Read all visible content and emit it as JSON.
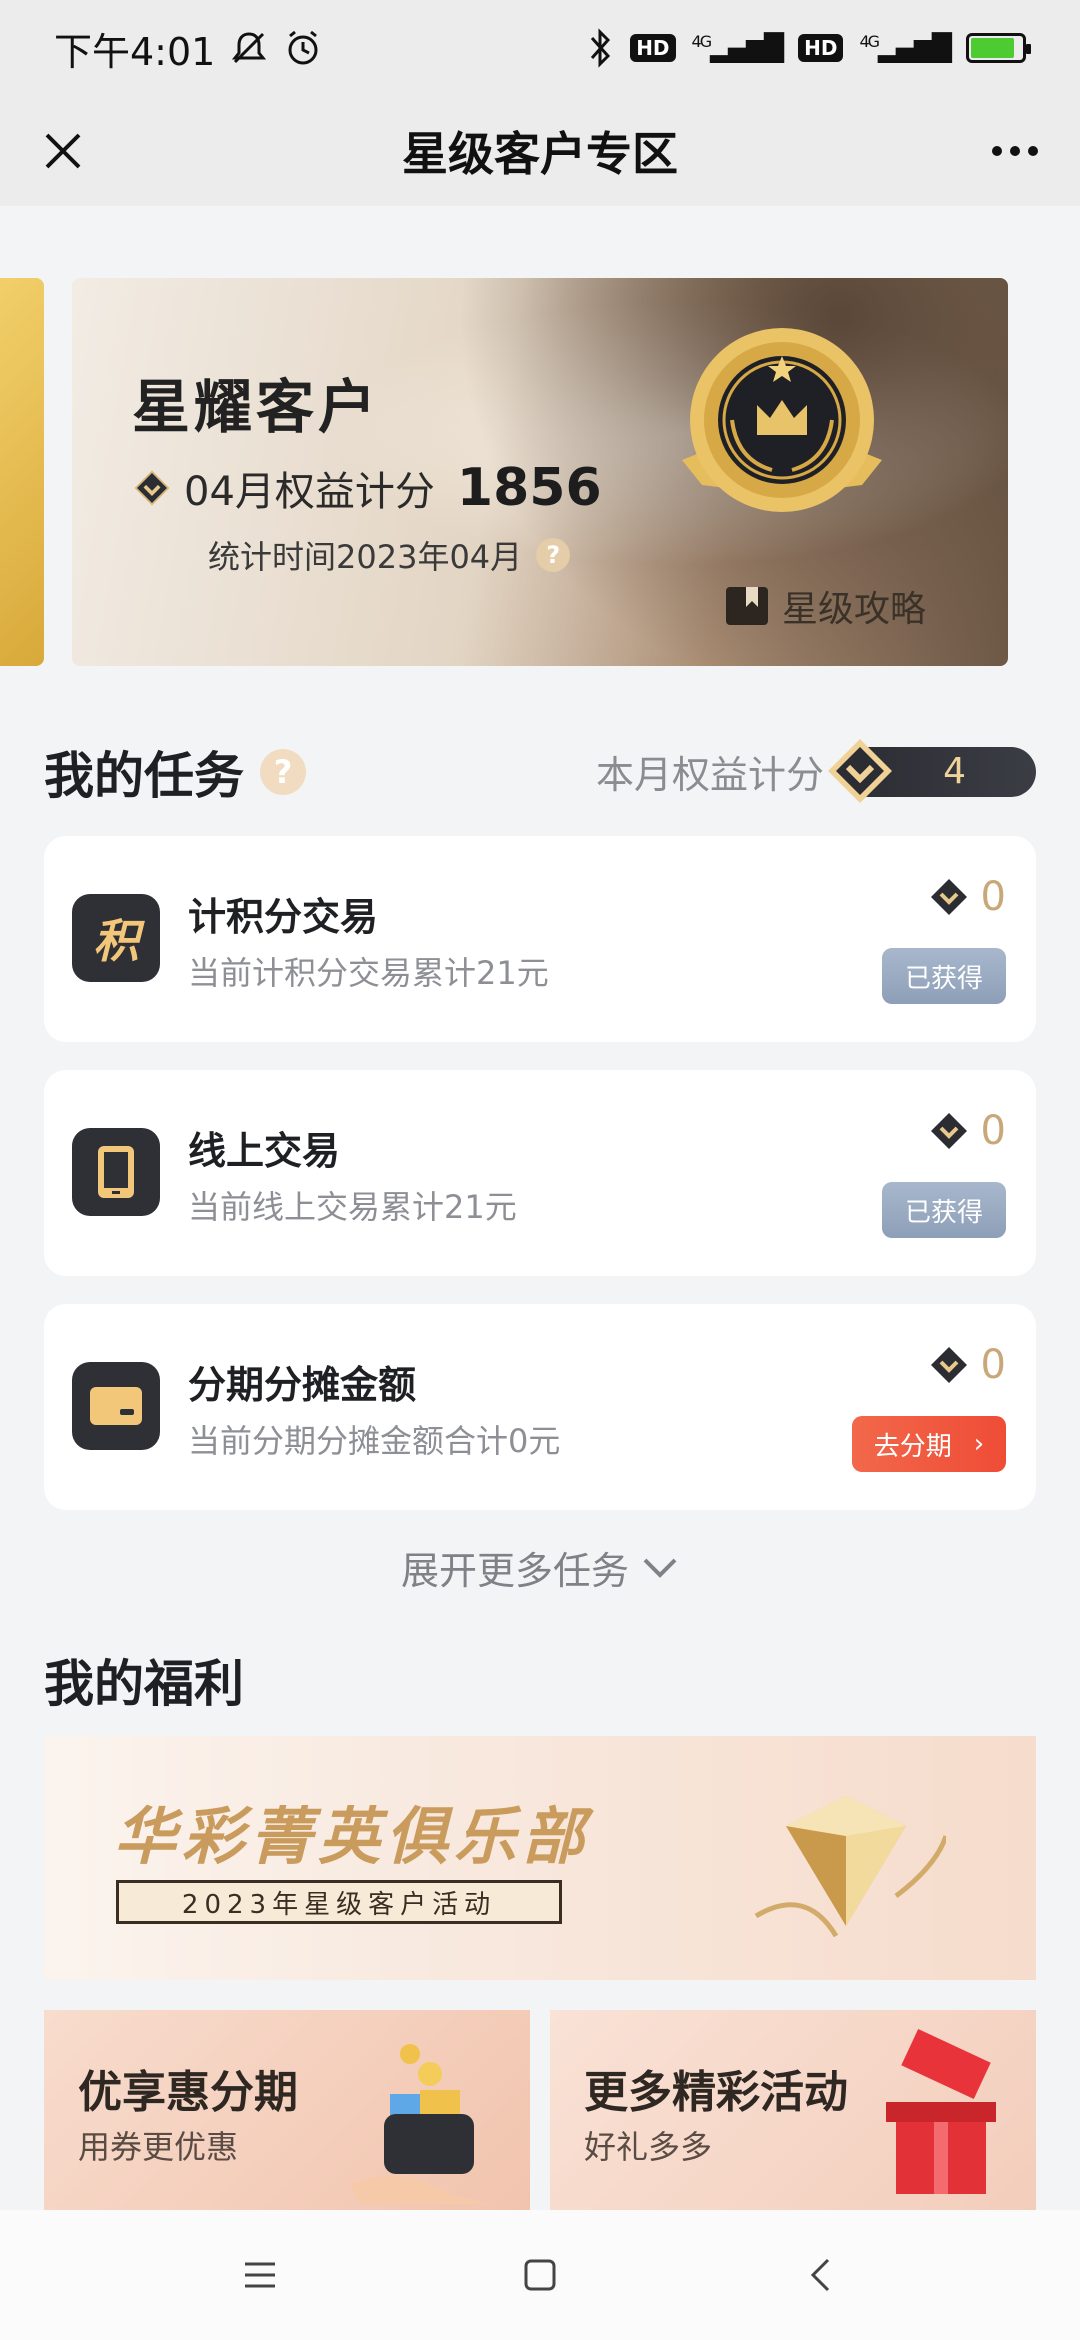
{
  "status_bar": {
    "time": "下午4:01",
    "network1": "4G",
    "network2": "4G",
    "hd": "HD",
    "battery_level": 0.85
  },
  "nav": {
    "title": "星级客户专区"
  },
  "hero": {
    "title": "星耀客户",
    "month_label": "04月权益计分",
    "score": "1856",
    "stat_time": "统计时间2023年04月",
    "guide": "星级攻略",
    "help_mark": "?"
  },
  "tasks_section": {
    "title": "我的任务",
    "help_mark": "?",
    "month_score_label": "本月权益计分",
    "month_score": "4",
    "expand_label": "展开更多任务",
    "items": [
      {
        "title": "计积分交易",
        "desc": "当前计积分交易累计21元",
        "points": "0",
        "button": "已获得",
        "icon_char": "积",
        "icon": "points-icon"
      },
      {
        "title": "线上交易",
        "desc": "当前线上交易累计21元",
        "points": "0",
        "button": "已获得",
        "icon": "phone-icon"
      },
      {
        "title": "分期分摊金额",
        "desc": "当前分期分摊金额合计0元",
        "points": "0",
        "button": "去分期",
        "button_arrow": "›",
        "icon": "card-icon"
      }
    ]
  },
  "benefits_section": {
    "title": "我的福利",
    "banner_title": "华彩菁英俱乐部",
    "banner_sub": "2023年星级客户活动",
    "promos": [
      {
        "title": "优享惠分期",
        "sub": "用券更优惠"
      },
      {
        "title": "更多精彩活动",
        "sub": "好礼多多"
      }
    ]
  },
  "colors": {
    "accent_orange": "#ef4c36",
    "gold": "#c8a878",
    "done_button": "#8d9fb8"
  }
}
